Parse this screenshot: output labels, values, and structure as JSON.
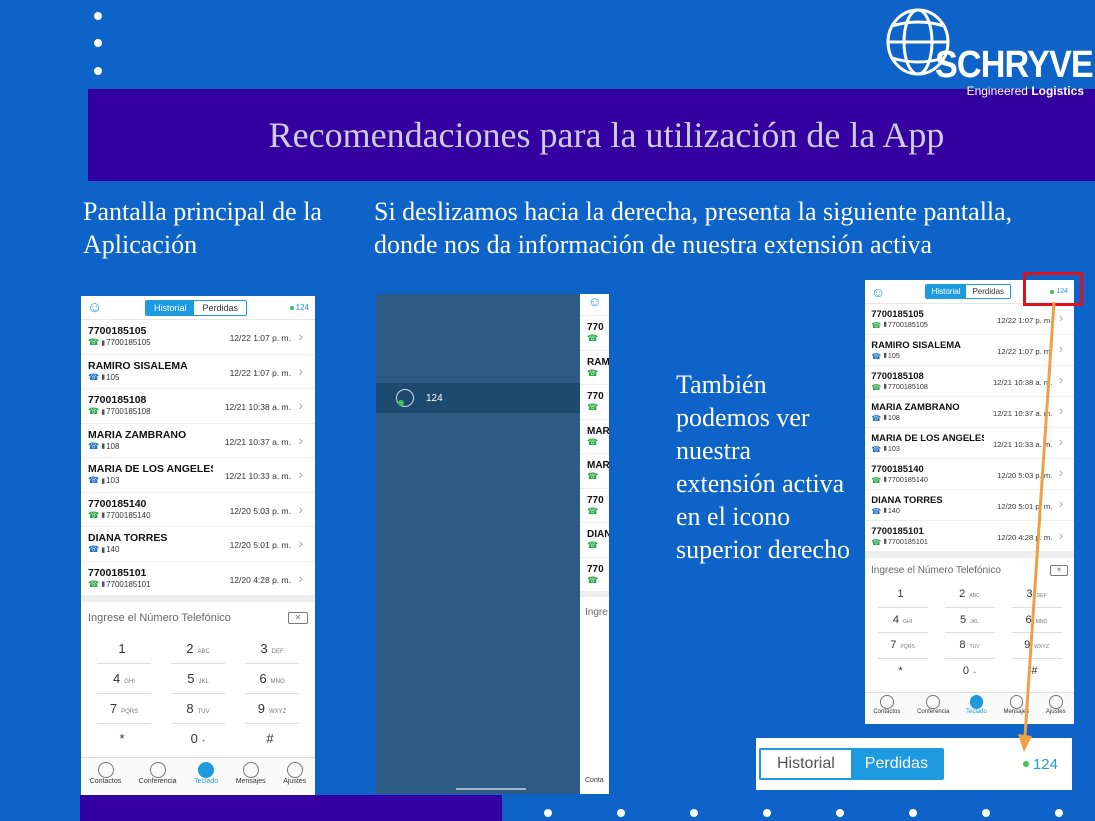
{
  "slide": {
    "title": "Recomendaciones para la utilización de la App",
    "col1_text": "Pantalla principal de la Aplicación",
    "col2_text": "Si deslizamos hacia la derecha, presenta la siguiente pantalla, donde nos da información de nuestra extensión activa",
    "col3_text": "También podemos ver nuestra extensión activa en el icono superior derecho"
  },
  "logo": {
    "brand": "SCHRYVER",
    "tag_light": "Engineered",
    "tag_bold": "Logistics"
  },
  "phone": {
    "tabs": [
      "Historial",
      "Perdidas"
    ],
    "extension": "124",
    "calls": [
      {
        "name": "7700185105",
        "number": "7700185105",
        "date": "12/22 1:07 p. m."
      },
      {
        "name": "RAMIRO SISALEMA",
        "number": "105",
        "date": "12/22 1:07 p. m."
      },
      {
        "name": "7700185108",
        "number": "7700185108",
        "date": "12/21 10:38 a. m."
      },
      {
        "name": "MARIA ZAMBRANO",
        "number": "108",
        "date": "12/21 10:37 a. m."
      },
      {
        "name": "MARIA DE LOS ANGELES...",
        "number": "103",
        "date": "12/21 10:33 a. m."
      },
      {
        "name": "7700185140",
        "number": "7700185140",
        "date": "12/20 5:03 p. m."
      },
      {
        "name": "DIANA TORRES",
        "number": "140",
        "date": "12/20 5:01 p. m."
      },
      {
        "name": "7700185101",
        "number": "7700185101",
        "date": "12/20 4:28 p. m."
      }
    ],
    "dial_placeholder": "Ingrese el Número Telefónico",
    "keys": [
      {
        "d": "1",
        "l": ""
      },
      {
        "d": "2",
        "l": "ABC"
      },
      {
        "d": "3",
        "l": "DEF"
      },
      {
        "d": "4",
        "l": "GHI"
      },
      {
        "d": "5",
        "l": "JKL"
      },
      {
        "d": "6",
        "l": "MNO"
      },
      {
        "d": "7",
        "l": "PQRS"
      },
      {
        "d": "8",
        "l": "TUV"
      },
      {
        "d": "9",
        "l": "WXYZ"
      },
      {
        "d": "*",
        "l": ""
      },
      {
        "d": "0",
        "l": "+"
      },
      {
        "d": "#",
        "l": ""
      }
    ],
    "nav": [
      "Contactos",
      "Conferencia",
      "Teclado",
      "Mensajes",
      "Ajustes"
    ]
  },
  "drawer": {
    "extension": "124",
    "peek_names": [
      "770",
      "RAM",
      "770",
      "MAR",
      "MAR",
      "770",
      "DIAN",
      "770"
    ],
    "peek_input": "Ingre",
    "peek_nav": "Conta"
  },
  "zoom": {
    "tabs": [
      "Historial",
      "Perdidas"
    ],
    "extension": "124"
  },
  "colors": {
    "slide_bg": "#0d63c7",
    "title_bg": "#3400a0",
    "accent": "#1e9be0",
    "green": "#3cc35c",
    "highlight": "#e0101a",
    "arrow": "#f0a040"
  }
}
